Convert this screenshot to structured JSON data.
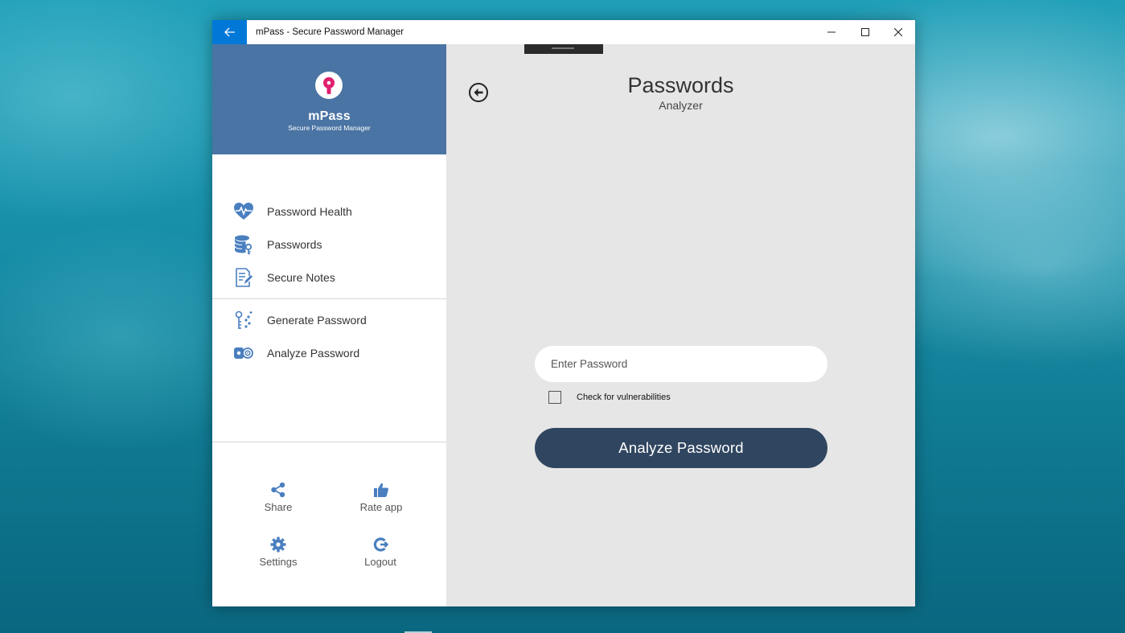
{
  "window": {
    "title": "mPass - Secure Password Manager"
  },
  "sidebar": {
    "app_name": "mPass",
    "app_tagline": "Secure Password Manager",
    "items": [
      {
        "label": "Password Health",
        "icon": "heart-pulse-icon"
      },
      {
        "label": "Passwords",
        "icon": "database-key-icon"
      },
      {
        "label": "Secure Notes",
        "icon": "note-pencil-icon"
      },
      {
        "label": "Generate Password",
        "icon": "generate-key-icon"
      },
      {
        "label": "Analyze Password",
        "icon": "analyze-key-icon"
      }
    ],
    "footer": [
      {
        "label": "Share",
        "icon": "share-icon"
      },
      {
        "label": "Rate app",
        "icon": "thumbs-up-icon"
      },
      {
        "label": "Settings",
        "icon": "gear-icon"
      },
      {
        "label": "Logout",
        "icon": "logout-icon"
      }
    ]
  },
  "main": {
    "title": "Passwords",
    "subtitle": "Analyzer",
    "password_placeholder": "Enter Password",
    "checkbox_label": "Check for vulnerabilities",
    "checkbox_checked": false,
    "analyze_button": "Analyze Password"
  },
  "colors": {
    "accent_blue": "#0078d7",
    "header_blue": "#4a74a3",
    "icon_blue": "#4a7fc0",
    "button_navy": "#304660",
    "logo_pink": "#e0206e"
  }
}
